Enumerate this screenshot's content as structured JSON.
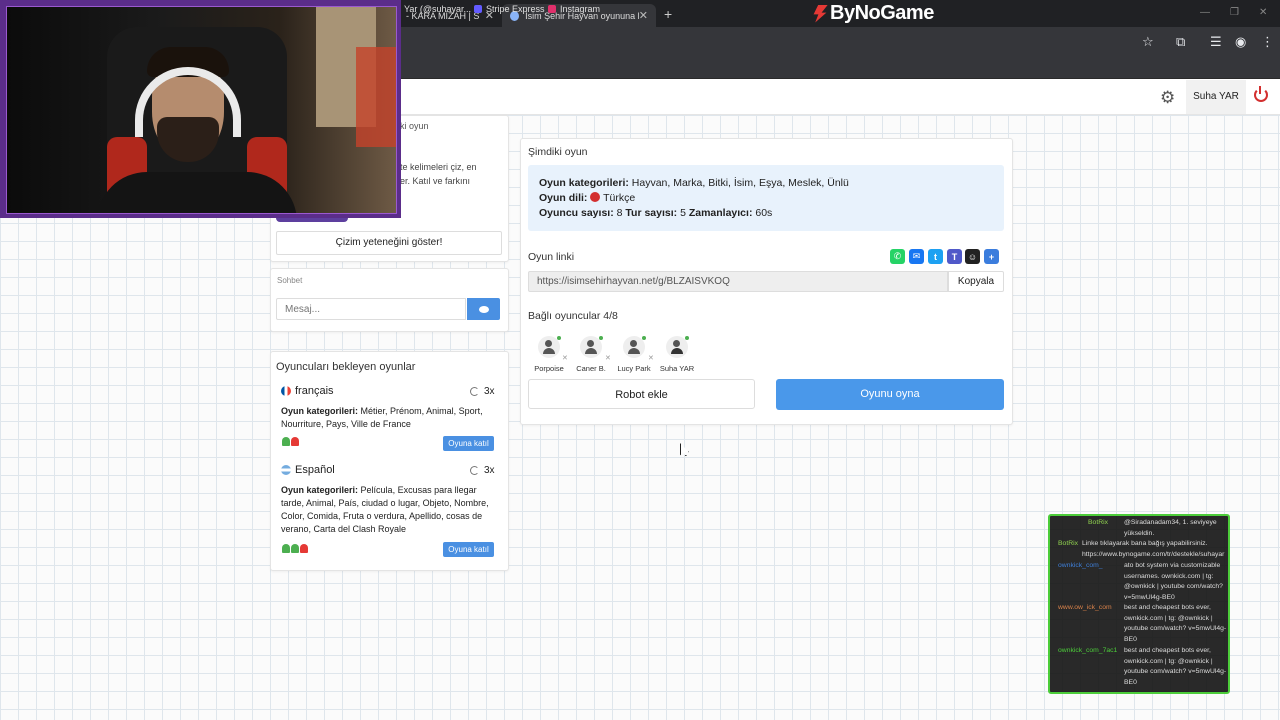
{
  "browser": {
    "tabs": [
      {
        "title": "- KARA MİZAH | S",
        "active": false
      },
      {
        "title": "İsim Şehir Hayvan oyununa kat",
        "active": true
      }
    ],
    "bookmarks": [
      {
        "label": "Yar (@suhayar...",
        "color": "#9b59b6"
      },
      {
        "label": "Stripe Express",
        "color": "#635bff"
      },
      {
        "label": "Instagram",
        "color": "#e1306c"
      }
    ]
  },
  "site": {
    "brand": "ByNoGame",
    "username": "Suha YAR"
  },
  "left": {
    "prev_game_title": "ki oyun",
    "promo_text": "te kelimeleri çiz, en\ner. Katıl ve farkını",
    "draw_button": "Çizim yeteneğini göster!",
    "chat_label": "Sohbet",
    "chat_placeholder": "Mesaj..."
  },
  "waiting": {
    "title": "Oyuncuları bekleyen oyunlar",
    "join_label": "Oyuna katıl",
    "games": [
      {
        "language": "français",
        "rounds": "3x",
        "categories_label": "Oyun kategorileri:",
        "categories": "Métier, Prénom, Animal, Sport, Nourriture, Pays, Ville de France",
        "players": [
          "#4caf50",
          "#e53935"
        ]
      },
      {
        "language": "Español",
        "rounds": "3x",
        "categories_label": "Oyun kategorileri:",
        "categories": "Película, Excusas para llegar tarde, Animal, País, ciudad o lugar, Objeto, Nombre, Color, Comida, Fruta o verdura, Apellido, cosas de verano, Carta del Clash Royale",
        "players": [
          "#4caf50",
          "#4caf50",
          "#e53935"
        ]
      }
    ]
  },
  "current": {
    "title": "Şimdiki oyun",
    "categories_label": "Oyun kategorileri:",
    "categories": "Hayvan, Marka, Bitki, İsim, Eşya, Meslek, Ünlü",
    "language_label": "Oyun dili:",
    "language": "Türkçe",
    "players_label": "Oyuncu sayısı:",
    "players_count": "8",
    "rounds_label": "Tur sayısı:",
    "rounds_count": "5",
    "timer_label": "Zamanlayıcı:",
    "timer": "60s",
    "link_label": "Oyun linki",
    "link": "https://isimsehirhayvan.net/g/BLZAISVKOQ",
    "copy_label": "Kopyala",
    "connected_label": "Bağlı oyuncular 4/8",
    "players": [
      "Porpoise",
      "Caner B.",
      "Lucy Park",
      "Suha YAR"
    ],
    "robot_button": "Robot ekle",
    "play_button": "Oyunu oyna",
    "share_icons": [
      {
        "name": "whatsapp-icon",
        "color": "#25d366",
        "glyph": "✆"
      },
      {
        "name": "messenger-icon",
        "color": "#1877f2",
        "glyph": "✉"
      },
      {
        "name": "twitter-icon",
        "color": "#1da1f2",
        "glyph": "t"
      },
      {
        "name": "teams-icon",
        "color": "#5059c9",
        "glyph": "T"
      },
      {
        "name": "snapchat-icon",
        "color": "#222222",
        "glyph": "☺"
      },
      {
        "name": "more-share-icon",
        "color": "#3b7ddd",
        "glyph": "+"
      }
    ]
  },
  "stream_chat": {
    "messages": [
      {
        "user": "BotRix",
        "user_color": "#8fd14f",
        "text": "@Siradanadam34, 1. seviyeye yükseldin."
      },
      {
        "user": "BotRix",
        "user_color": "#8fd14f",
        "text": "Linke tıklayarak bana bağış yapabilirsiniz. https://www.bynogame.com/tr/destekle/suhayar"
      },
      {
        "user": "ownkick_com_",
        "user_color": "#3f7fd9",
        "text": "ato bot system via customizable usernames. ownkick.com | tg: @ownkick | youtube com/watch?v=5mwUl4g-BE0"
      },
      {
        "user": "www.ow_ick_com",
        "user_color": "#d9824a",
        "text": "best and cheapest bots ever, ownkick.com | tg: @ownkick | youtube com/watch? v=5mwUl4g-BE0"
      },
      {
        "user": "ownkick_com_7ac1",
        "user_color": "#4ccd3a",
        "text": "best and cheapest bots ever, ownkick.com | tg: @ownkick | youtube com/watch? v=5mwUl4g-BE0"
      }
    ]
  }
}
